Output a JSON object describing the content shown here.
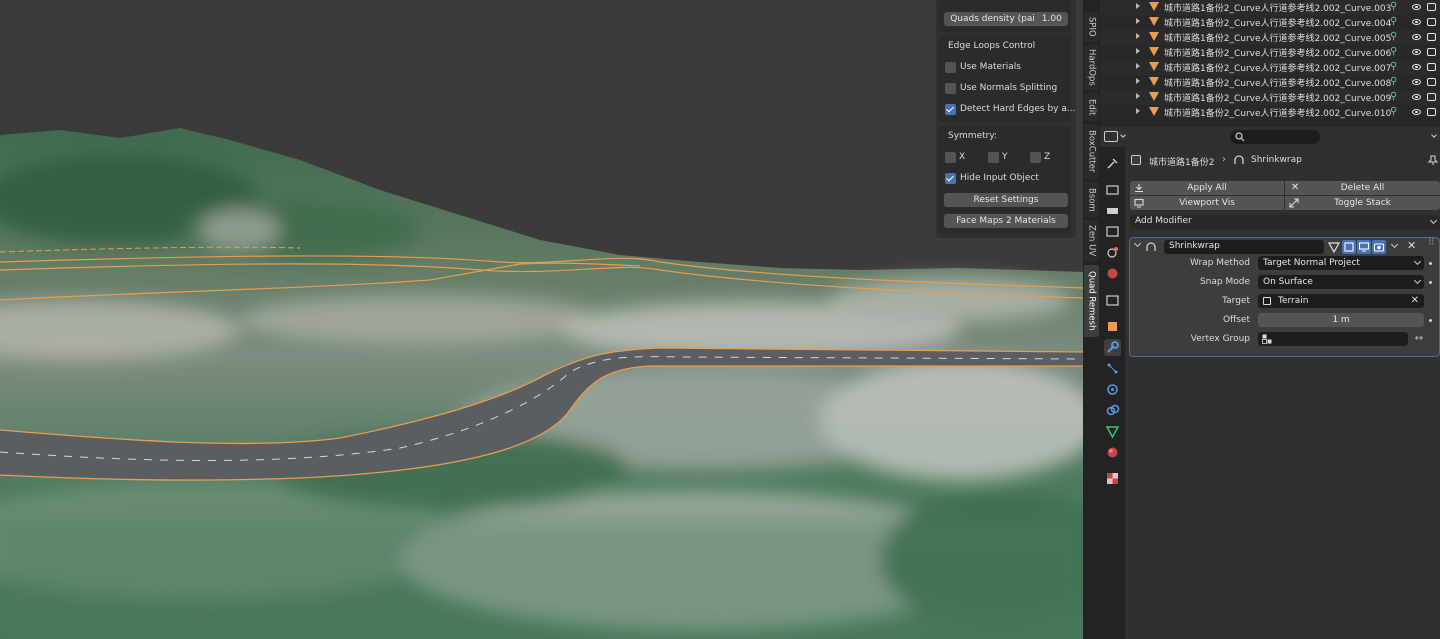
{
  "npanel": {
    "quads_density_label": "Quads density (pai",
    "quads_density_value": "1.00",
    "edge_loops_title": "Edge Loops Control",
    "use_materials": "Use Materials",
    "use_normals_splitting": "Use Normals Splitting",
    "detect_hard_edges": "Detect Hard Edges by a...",
    "symmetry_title": "Symmetry:",
    "sym_x": "X",
    "sym_y": "Y",
    "sym_z": "Z",
    "hide_input_object": "Hide Input Object",
    "reset_settings": "Reset Settings",
    "face_maps_2_materials": "Face Maps 2 Materials"
  },
  "vertical_tabs": [
    "SPIO",
    "HardOps",
    "Edit",
    "BoxCutter",
    "Bsom",
    "Zen UV",
    "Quad Remesh"
  ],
  "outliner": {
    "rows": [
      "城市道路1备份2_Curve人行道参考线2.002_Curve.003",
      "城市道路1备份2_Curve人行道参考线2.002_Curve.004",
      "城市道路1备份2_Curve人行道参考线2.002_Curve.005",
      "城市道路1备份2_Curve人行道参考线2.002_Curve.006",
      "城市道路1备份2_Curve人行道参考线2.002_Curve.007",
      "城市道路1备份2_Curve人行道参考线2.002_Curve.008",
      "城市道路1备份2_Curve人行道参考线2.002_Curve.009",
      "城市道路1备份2_Curve人行道参考线2.002_Curve.010"
    ]
  },
  "properties": {
    "breadcrumb_object": "城市道路1备份2",
    "breadcrumb_modifier": "Shrinkwrap",
    "apply_all": "Apply All",
    "delete_all": "Delete All",
    "viewport_vis": "Viewport Vis",
    "toggle_stack": "Toggle Stack",
    "add_modifier": "Add Modifier",
    "modifier": {
      "name": "Shrinkwrap",
      "wrap_method_label": "Wrap Method",
      "wrap_method_value": "Target Normal Project",
      "snap_mode_label": "Snap Mode",
      "snap_mode_value": "On Surface",
      "target_label": "Target",
      "target_value": "Terrain",
      "offset_label": "Offset",
      "offset_value": "1 m",
      "vertex_group_label": "Vertex Group",
      "vertex_group_value": ""
    }
  },
  "colors": {
    "accent": "#4772b3",
    "selection_outline": "#e89d4f",
    "terrain": "#3f6e52"
  }
}
